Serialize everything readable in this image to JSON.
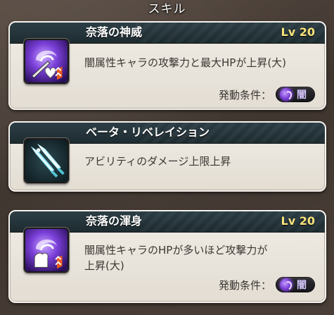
{
  "header": {
    "title": "スキル"
  },
  "skills": [
    {
      "name": "奈落の神威",
      "level": "Lv 20",
      "description": "闇属性キャラの攻撃力と最大HPが上昇(大)",
      "condition_label": "発動条件：",
      "condition_value": "闇",
      "icon": "dark-sword-heart-icon"
    },
    {
      "name": "ベータ・リベレイション",
      "description": "アビリティのダメージ上限上昇",
      "icon": "twin-blades-icon"
    },
    {
      "name": "奈落の渾身",
      "level": "Lv 20",
      "description_line1": "闇属性キャラのHPが多いほど攻撃力が",
      "description_line2": "上昇(大)",
      "condition_label": "発動条件：",
      "condition_value": "闇",
      "icon": "dark-arm-icon"
    }
  ],
  "colors": {
    "level": "#f7e27a",
    "dark_element": "#7b3ed6",
    "card_bg": "#e9e4dc",
    "card_head": "#24353b"
  }
}
